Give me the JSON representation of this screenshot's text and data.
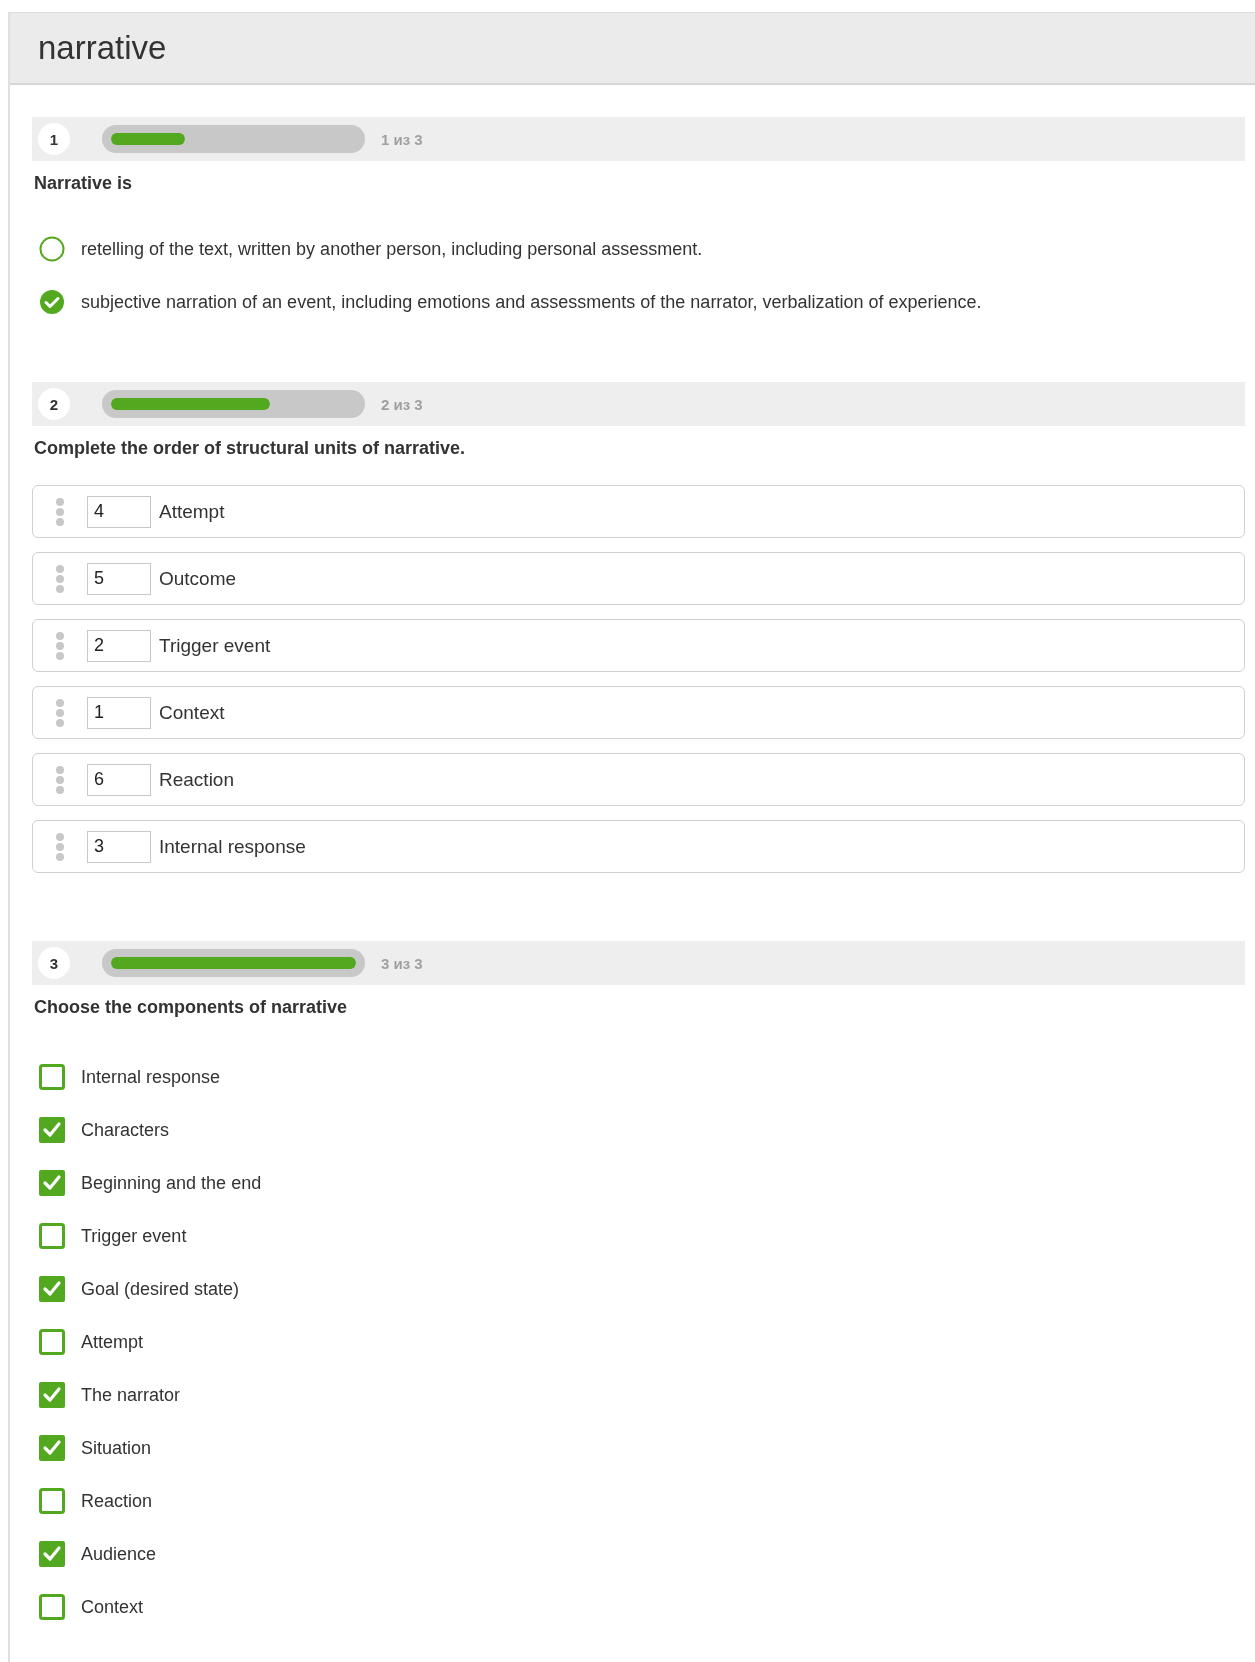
{
  "title": "narrative",
  "questions": [
    {
      "kind": "single",
      "number": "1",
      "progress": "1 из 3",
      "level": 0.3333,
      "text": "Narrative is",
      "options": [
        {
          "label": "retelling of the text, written by another person, including personal assessment.",
          "selected": false
        },
        {
          "label": "subjective narration of an event, including emotions and assessments of the narrator, verbalization of experience.",
          "selected": true
        }
      ]
    },
    {
      "kind": "order",
      "number": "2",
      "progress": "2 из 3",
      "level": 0.6667,
      "text": "Complete the order of structural units of narrative.",
      "items": [
        {
          "value": "4",
          "label": "Attempt"
        },
        {
          "value": "5",
          "label": "Outcome"
        },
        {
          "value": "2",
          "label": "Trigger event"
        },
        {
          "value": "1",
          "label": "Context"
        },
        {
          "value": "6",
          "label": "Reaction"
        },
        {
          "value": "3",
          "label": "Internal response"
        }
      ]
    },
    {
      "kind": "multi",
      "number": "3",
      "progress": "3 из 3",
      "level": 1,
      "text": "Choose the components of narrative",
      "options": [
        {
          "label": "Internal response",
          "checked": false
        },
        {
          "label": "Characters",
          "checked": true
        },
        {
          "label": "Beginning and the end",
          "checked": true
        },
        {
          "label": "Trigger event",
          "checked": false
        },
        {
          "label": "Goal (desired state)",
          "checked": true
        },
        {
          "label": "Attempt",
          "checked": false
        },
        {
          "label": "The narrator",
          "checked": true
        },
        {
          "label": "Situation",
          "checked": true
        },
        {
          "label": "Reaction",
          "checked": false
        },
        {
          "label": "Audience",
          "checked": true
        },
        {
          "label": "Context",
          "checked": false
        }
      ]
    }
  ]
}
